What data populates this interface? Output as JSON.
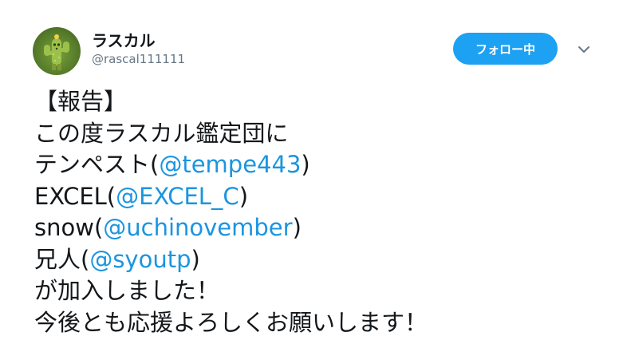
{
  "tweet": {
    "author": {
      "name": "ラスカル",
      "handle": "@rascal111111"
    },
    "follow_button_label": "フォロー中",
    "lines": [
      {
        "text": "【報告】"
      },
      {
        "text": "この度ラスカル鑑定団に"
      },
      {
        "prefix": "テンペスト(",
        "mention": "@tempe443",
        "suffix": ")"
      },
      {
        "prefix": "EXCEL(",
        "mention": "@EXCEL_C",
        "suffix": ")"
      },
      {
        "prefix": "snow(",
        "mention": "@uchinovember",
        "suffix": ")"
      },
      {
        "prefix": "兄人(",
        "mention": "@syoutp",
        "suffix": ")"
      },
      {
        "text": "が加入しました！"
      },
      {
        "text": "今後とも応援よろしくお願いします！"
      }
    ]
  },
  "colors": {
    "accent": "#1da1f2",
    "mention": "#1b95e0",
    "text": "#14171a",
    "secondary": "#657786"
  },
  "icons": {
    "avatar": "cactus-avatar",
    "menu": "chevron-down-icon"
  }
}
